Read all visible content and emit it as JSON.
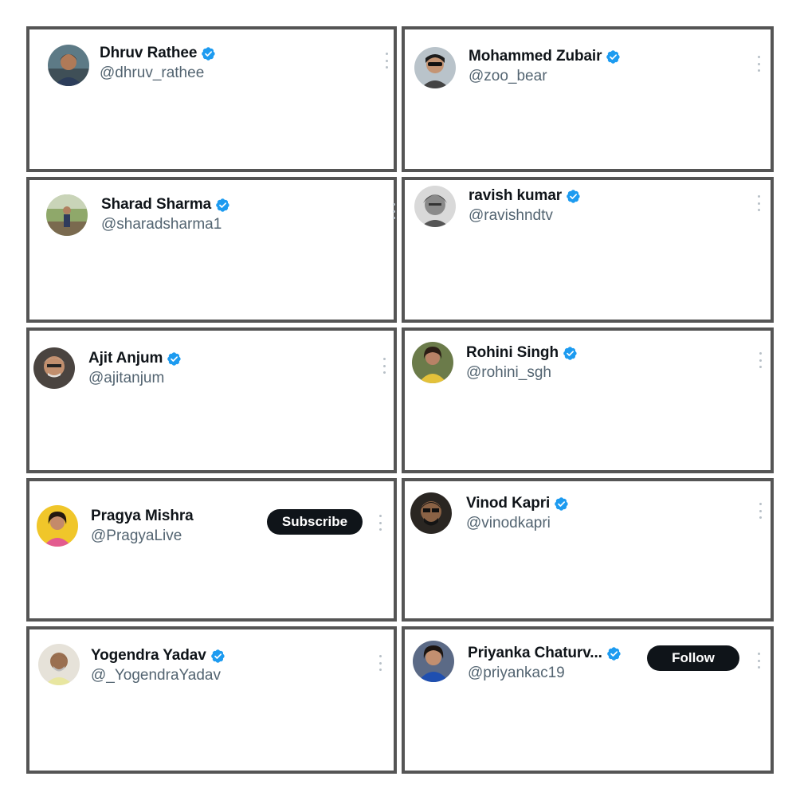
{
  "theme": {
    "verified_color": "#1d9bf0",
    "name_color": "#0f1419",
    "handle_color": "#536471",
    "button_bg": "#0f1419",
    "frame_color": "#555555"
  },
  "accounts": [
    {
      "name": "Dhruv Rathee",
      "handle": "@dhruv_rathee",
      "verified": true,
      "avatar_icon": "profile-photo"
    },
    {
      "name": "Mohammed Zubair",
      "handle": "@zoo_bear",
      "verified": true,
      "avatar_icon": "profile-photo"
    },
    {
      "name": "Sharad Sharma",
      "handle": "@sharadsharma1",
      "verified": true,
      "avatar_icon": "profile-photo"
    },
    {
      "name": "ravish kumar",
      "handle": "@ravishndtv",
      "verified": true,
      "avatar_icon": "profile-photo"
    },
    {
      "name": "Ajit Anjum",
      "handle": "@ajitanjum",
      "verified": true,
      "avatar_icon": "profile-photo"
    },
    {
      "name": "Rohini Singh",
      "handle": "@rohini_sgh",
      "verified": true,
      "avatar_icon": "profile-photo"
    },
    {
      "name": "Pragya Mishra",
      "handle": "@PragyaLive",
      "verified": false,
      "avatar_icon": "profile-photo",
      "button": "Subscribe"
    },
    {
      "name": "Vinod Kapri",
      "handle": "@vinodkapri",
      "verified": true,
      "avatar_icon": "profile-photo"
    },
    {
      "name": "Yogendra Yadav",
      "handle": "@_YogendraYadav",
      "verified": true,
      "avatar_icon": "profile-photo"
    },
    {
      "name": "Priyanka Chaturv...",
      "handle": "@priyankac19",
      "verified": true,
      "avatar_icon": "profile-photo",
      "button": "Follow"
    }
  ]
}
